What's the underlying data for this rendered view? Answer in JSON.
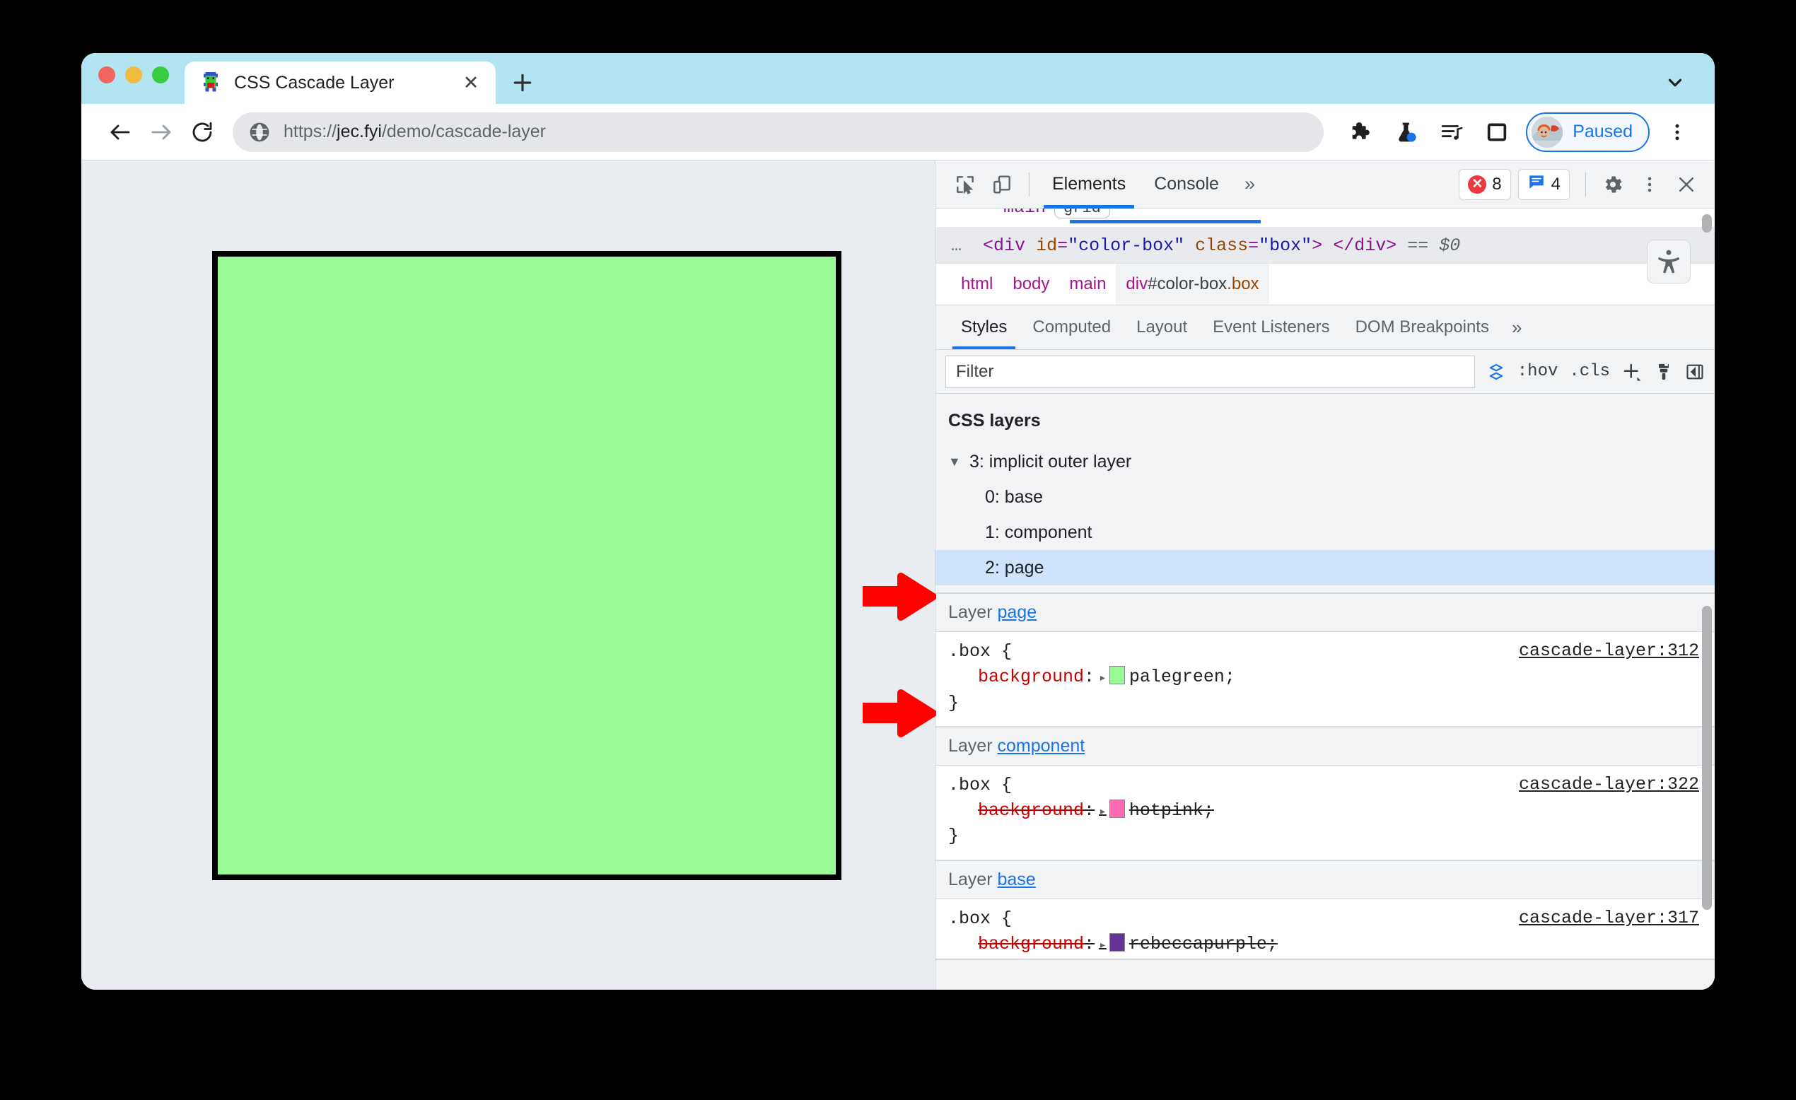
{
  "browser": {
    "tab": {
      "title": "CSS Cascade Layer",
      "favicon": "pixel-monster-favicon",
      "close_label": "✕"
    },
    "new_tab_label": "+",
    "tabstrip_chevron": "chevron-down-icon",
    "toolbar": {
      "back": "back-arrow-icon",
      "forward": "forward-arrow-icon",
      "reload": "reload-icon",
      "site_icon": "globe-icon",
      "url_scheme": "https://",
      "url_host": "jec.fyi",
      "url_path": "/demo/cascade-layer",
      "url_full": "https://jec.fyi/demo/cascade-layer",
      "extensions": "puzzle-piece-icon",
      "experiments": "flask-icon",
      "reading_list": "playlist-icon",
      "side_panel": "side-panel-icon",
      "profile_label": "Paused",
      "menu": "three-dot-menu-icon"
    }
  },
  "page": {
    "box_color": "#98fb98",
    "box_border_color": "#000000",
    "background": "#e9edf2"
  },
  "annotations": {
    "arrow_color": "#ff0000",
    "arrow1_target": "css-layers-heading",
    "arrow2_target": "layer-page-rule-header"
  },
  "devtools": {
    "topbar": {
      "inspect_icon": "inspect-element-icon",
      "device_icon": "device-toolbar-icon",
      "tabs": [
        {
          "label": "Elements",
          "active": true
        },
        {
          "label": "Console",
          "active": false
        }
      ],
      "more_tabs": "»",
      "errors_count": "8",
      "warnings_count": "4",
      "settings_icon": "gear-icon",
      "menu_icon": "three-dot-menu-icon",
      "close_icon": "close-icon"
    },
    "dom": {
      "cut_row_text": "main",
      "cut_row_badge": "grid",
      "ellipsis": "…",
      "selected_node": {
        "open_lt": "<",
        "tag": "div",
        "attr1_name": "id",
        "attr1_value": "\"color-box\"",
        "attr2_name": "class",
        "attr2_value": "\"box\"",
        "open_gt": ">",
        "close_tag": "</div>",
        "equals": "==",
        "console_ref": "$0"
      }
    },
    "breadcrumb": [
      {
        "el": "html",
        "id": "",
        "cls": ""
      },
      {
        "el": "body",
        "id": "",
        "cls": ""
      },
      {
        "el": "main",
        "id": "",
        "cls": ""
      },
      {
        "el": "div",
        "id": "#color-box",
        "cls": ".box",
        "active": true
      }
    ],
    "a11y_button": "accessibility-icon",
    "styles_tabs": [
      {
        "label": "Styles",
        "active": true
      },
      {
        "label": "Computed",
        "active": false
      },
      {
        "label": "Layout",
        "active": false
      },
      {
        "label": "Event Listeners",
        "active": false
      },
      {
        "label": "DOM Breakpoints",
        "active": false
      }
    ],
    "styles_tabs_more": "»",
    "filter": {
      "value": "",
      "placeholder": "Filter",
      "layers_icon": "css-layers-toggle-icon",
      "hov_label": ":hov",
      "cls_label": ".cls",
      "new_rule_label": "+",
      "copy_styles_icon": "paintbrush-icon",
      "sidebar_toggle_icon": "collapse-sidebar-icon"
    },
    "css_layers": {
      "heading": "CSS layers",
      "tree": [
        {
          "triangle": "▼",
          "label": "3: implicit outer layer",
          "depth": 0,
          "selected": false
        },
        {
          "triangle": "",
          "label": "0: base",
          "depth": 1,
          "selected": false
        },
        {
          "triangle": "",
          "label": "1: component",
          "depth": 1,
          "selected": false
        },
        {
          "triangle": "",
          "label": "2: page",
          "depth": 1,
          "selected": true
        }
      ]
    },
    "rules": [
      {
        "layer_prefix": "Layer",
        "layer_name": "page",
        "selector": ".box {",
        "closing": "}",
        "property": "background",
        "value": "palegreen",
        "swatch_color": "#98fb98",
        "overridden": false,
        "source": "cascade-layer:312"
      },
      {
        "layer_prefix": "Layer",
        "layer_name": "component",
        "selector": ".box {",
        "closing": "}",
        "property": "background",
        "value": "hotpink",
        "swatch_color": "#ff69b4",
        "overridden": true,
        "source": "cascade-layer:322"
      },
      {
        "layer_prefix": "Layer",
        "layer_name": "base",
        "selector": ".box {",
        "closing": "}",
        "property": "background",
        "value": "rebeccapurple",
        "swatch_color": "#663399",
        "overridden": true,
        "source": "cascade-layer:317"
      }
    ]
  }
}
